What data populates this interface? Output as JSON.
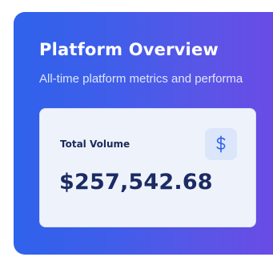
{
  "overview": {
    "title": "Platform Overview",
    "subtitle": "All-time platform metrics and performa"
  },
  "metric_card": {
    "label": "Total Volume",
    "value": "$257,542.68",
    "icon": "dollar-icon"
  },
  "colors": {
    "gradient_start": "#2f62eb",
    "gradient_end": "#6c4ae6",
    "card_background": "#eef3fb",
    "text_dark": "#1c2b63",
    "icon_accent": "#2f62eb"
  }
}
